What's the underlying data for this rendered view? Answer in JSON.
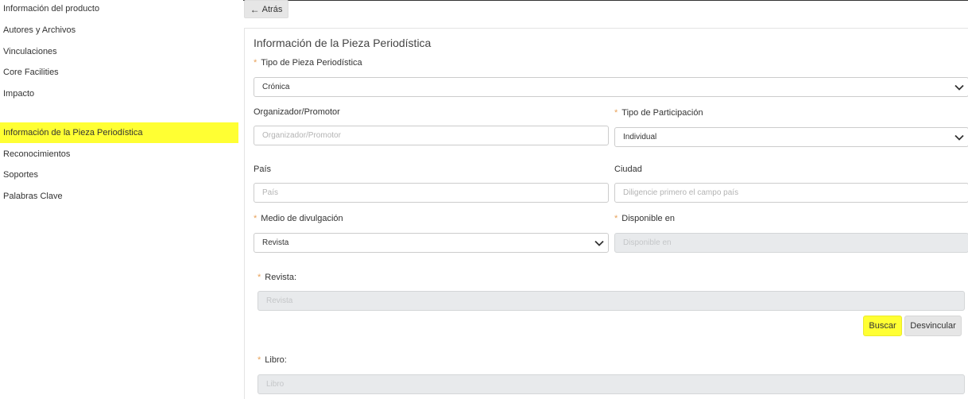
{
  "sidebar": {
    "items": [
      {
        "label": "Información del producto"
      },
      {
        "label": "Autores y Archivos"
      },
      {
        "label": "Vinculaciones"
      },
      {
        "label": "Core Facilities"
      },
      {
        "label": "Impacto"
      },
      {
        "label": "Información de la Pieza Periodística",
        "active": true
      },
      {
        "label": "Reconocimientos"
      },
      {
        "label": "Soportes"
      },
      {
        "label": "Palabras Clave"
      }
    ]
  },
  "toolbar": {
    "back_label": "Atrás"
  },
  "form": {
    "title": "Información de la Pieza Periodística",
    "required_mark": "*",
    "tipo_pieza": {
      "label": "Tipo de Pieza Periodística",
      "value": "Crónica"
    },
    "organizador": {
      "label": "Organizador/Promotor",
      "placeholder": "Organizador/Promotor"
    },
    "tipo_participacion": {
      "label": "Tipo de Participación",
      "value": "Individual"
    },
    "pais": {
      "label": "País",
      "placeholder": "País"
    },
    "ciudad": {
      "label": "Ciudad",
      "placeholder": "Diligencie primero el campo país"
    },
    "medio": {
      "label": "Medio de divulgación",
      "value": "Revista"
    },
    "disponible": {
      "label": "Disponible en",
      "placeholder": "Disponible en"
    },
    "revista": {
      "label": "Revista:",
      "placeholder": "Revista"
    },
    "buscar_label": "Buscar",
    "desvincular_label": "Desvincular",
    "libro": {
      "label": "Libro:",
      "placeholder": "Libro"
    }
  },
  "colors": {
    "highlight": "#ffff33",
    "required": "#e8a25a",
    "disabled_bg": "#e8eaec"
  }
}
